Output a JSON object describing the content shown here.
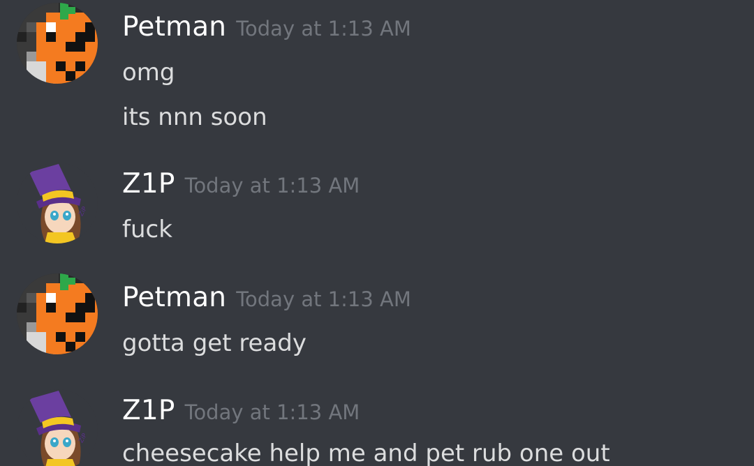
{
  "messages": [
    {
      "author": "Petman",
      "avatar": "pumpkin-pixel-avatar",
      "timestamp": "Today at 1:13 AM",
      "lines": [
        "omg",
        "its nnn soon"
      ]
    },
    {
      "author": "Z1P",
      "avatar": "hat-kid-avatar",
      "timestamp": "Today at 1:13 AM",
      "lines": [
        "fuck"
      ]
    },
    {
      "author": "Petman",
      "avatar": "pumpkin-pixel-avatar",
      "timestamp": "Today at 1:13 AM",
      "lines": [
        "gotta get ready"
      ]
    },
    {
      "author": "Z1P",
      "avatar": "hat-kid-avatar",
      "timestamp": "Today at 1:13 AM",
      "lines": [
        "cheesecake help me and pet rub one out"
      ]
    }
  ],
  "colors": {
    "background": "#36393f",
    "username": "#ffffff",
    "timestamp": "#72767d",
    "message_text": "#dcddde",
    "pumpkin_orange": "#f47b20",
    "stem_green": "#2ea84a",
    "hat_purple": "#6b3fa0",
    "hat_band_yellow": "#f3c623"
  }
}
